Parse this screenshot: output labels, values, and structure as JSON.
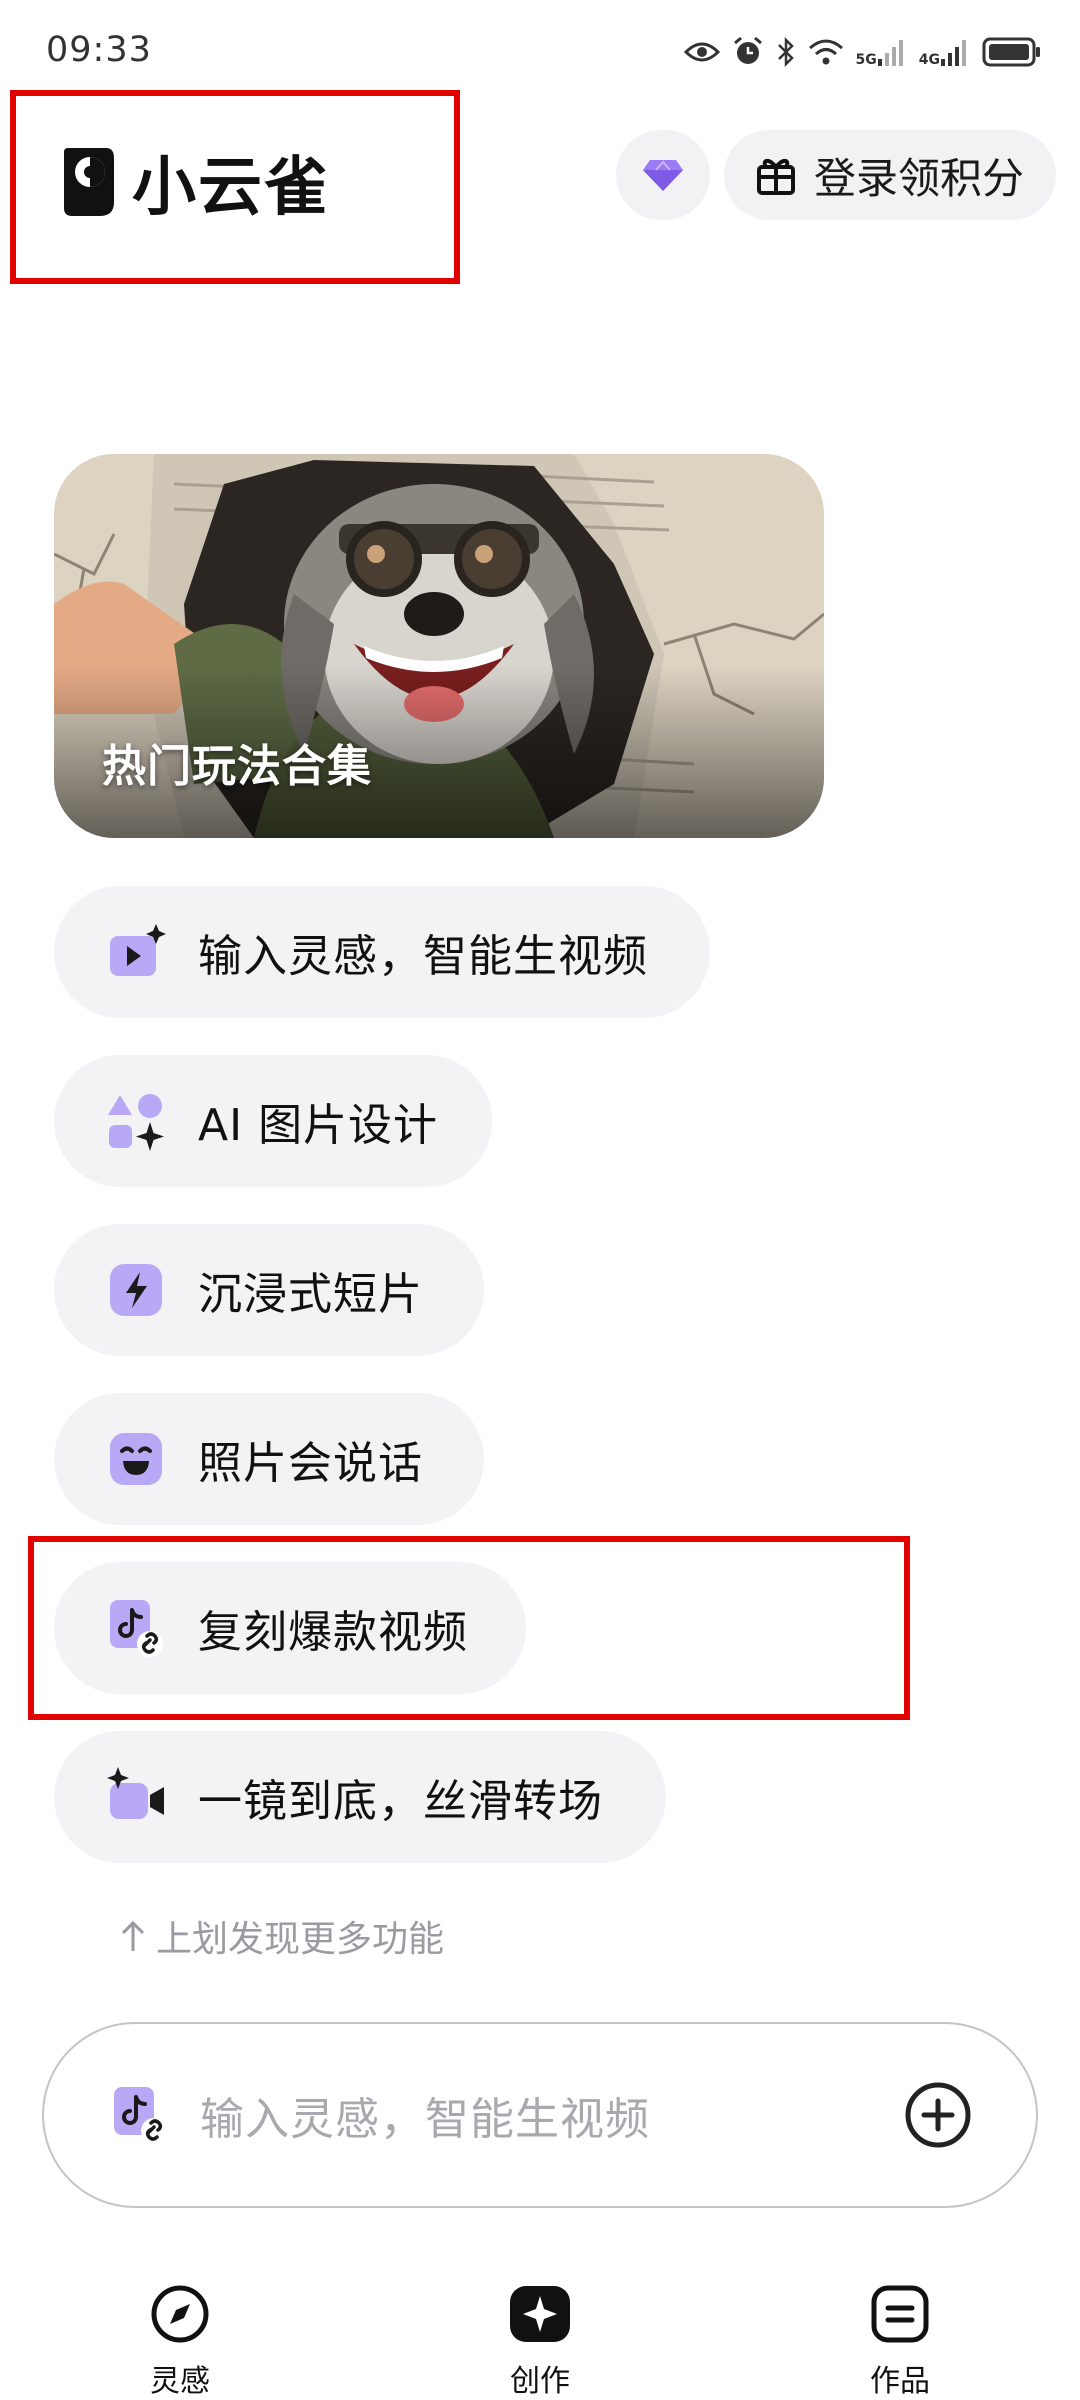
{
  "status_bar": {
    "time": "09:33",
    "net1": "5G",
    "net2": "4G"
  },
  "header": {
    "app_name": "小云雀",
    "login_label": "登录领积分"
  },
  "banner": {
    "title": "热门玩法合集"
  },
  "features": [
    {
      "label": "输入灵感，智能生视频",
      "icon": "video-sparkle-icon"
    },
    {
      "label": "AI 图片设计",
      "icon": "shapes-icon"
    },
    {
      "label": "沉浸式短片",
      "icon": "lightning-icon"
    },
    {
      "label": "照片会说话",
      "icon": "smile-face-icon"
    },
    {
      "label": "复刻爆款视频",
      "icon": "tiktok-link-icon"
    },
    {
      "label": "一镜到底，丝滑转场",
      "icon": "camera-sparkle-icon"
    }
  ],
  "hint": "上划发现更多功能",
  "input": {
    "placeholder": "输入灵感，智能生视频"
  },
  "bottom_nav": [
    {
      "label": "灵感",
      "icon": "compass-icon"
    },
    {
      "label": "创作",
      "icon": "sparkle-create-icon"
    },
    {
      "label": "作品",
      "icon": "works-icon"
    }
  ],
  "colors": {
    "accent": "#b8a8f5",
    "accent_dark": "#1a1a1a",
    "chip_bg": "#f3f3f6",
    "annotation": "#e00000"
  }
}
